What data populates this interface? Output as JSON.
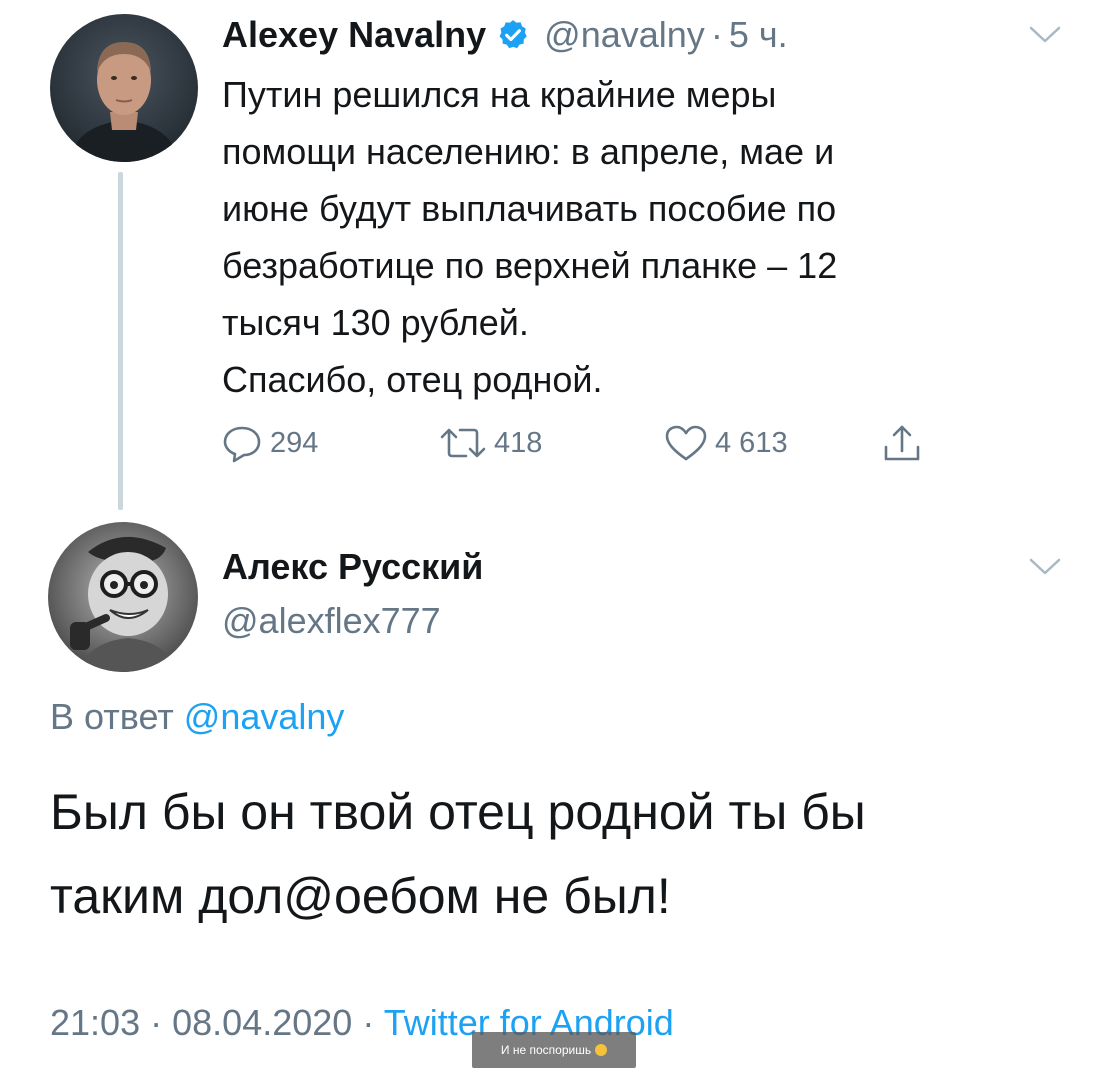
{
  "parent_tweet": {
    "author_name": "Alexey Navalny",
    "handle": "@navalny",
    "separator": "·",
    "time": "5 ч.",
    "lines": [
      "Путин решился на крайние меры",
      "помощи населению: в апреле, мае и",
      "июне будут выплачивать пособие по",
      "безработице по верхней планке – 12",
      "тысяч 130 рублей.",
      "Спасибо, отец родной."
    ],
    "actions": {
      "replies": "294",
      "retweets": "418",
      "likes": "4 613"
    },
    "icons": {
      "verified": "verified-badge-icon",
      "menu": "chevron-down-icon",
      "reply": "reply-bubble-icon",
      "retweet": "retweet-icon",
      "like": "heart-icon",
      "share": "share-icon"
    }
  },
  "reply_tweet": {
    "author_name": "Алекс Русский",
    "handle": "@alexflex777",
    "reply_prefix": "В ответ",
    "reply_mention": "@navalny",
    "lines": [
      "Был бы он твой отец родной ты бы",
      "таким дол@оебом не был!"
    ],
    "time": "21:03",
    "date": "08.04.2020",
    "separator": "·",
    "source": "Twitter for Android"
  },
  "watermark": {
    "text": "И не поспоришь"
  },
  "colors": {
    "text_primary": "#14171a",
    "text_secondary": "#657786",
    "accent_blue": "#1da1f2",
    "thread_line": "#ccd6dd"
  }
}
